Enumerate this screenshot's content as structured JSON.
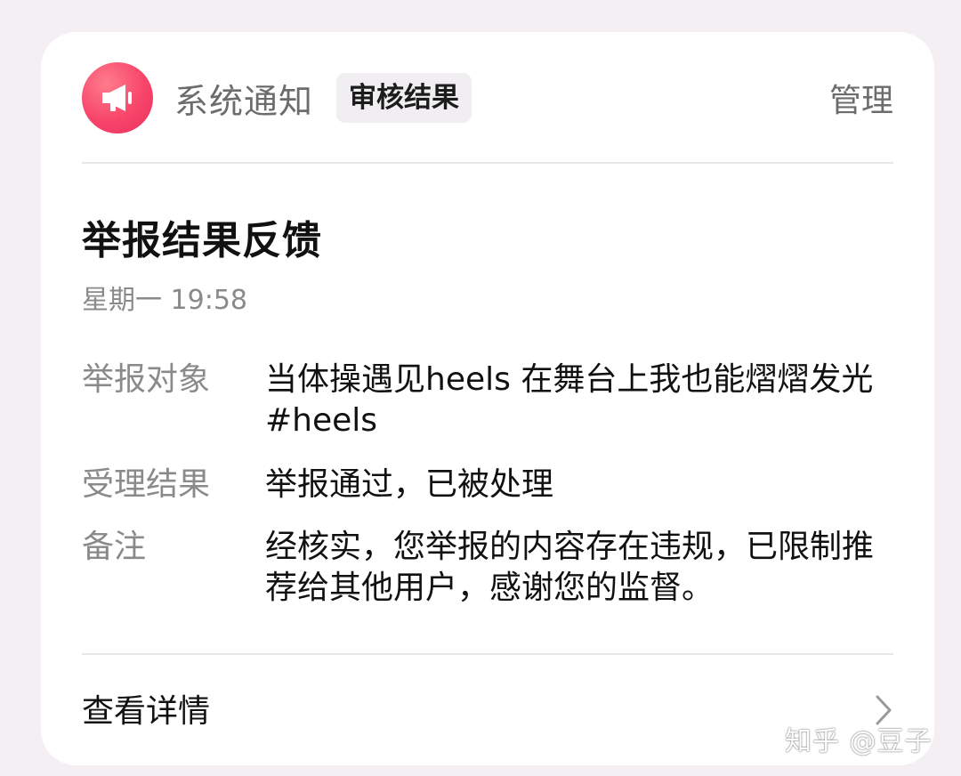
{
  "header": {
    "sender": "系统通知",
    "tag": "审核结果",
    "manage": "管理",
    "avatar_icon": "megaphone-icon",
    "avatar_color": "#f7456a"
  },
  "notification": {
    "title": "举报结果反馈",
    "time": "星期一 19:58",
    "rows": [
      {
        "label": "举报对象",
        "value": "当体操遇见heels 在舞台上我也能熠熠发光#heels"
      },
      {
        "label": "受理结果",
        "value": "举报通过，已被处理"
      },
      {
        "label": "备注",
        "value": "经核实，您举报的内容存在违规，已限制推荐给其他用户，感谢您的监督。"
      }
    ]
  },
  "footer": {
    "details_label": "查看详情",
    "chevron_icon": "chevron-right-icon"
  },
  "watermark": "知乎 @豆子"
}
